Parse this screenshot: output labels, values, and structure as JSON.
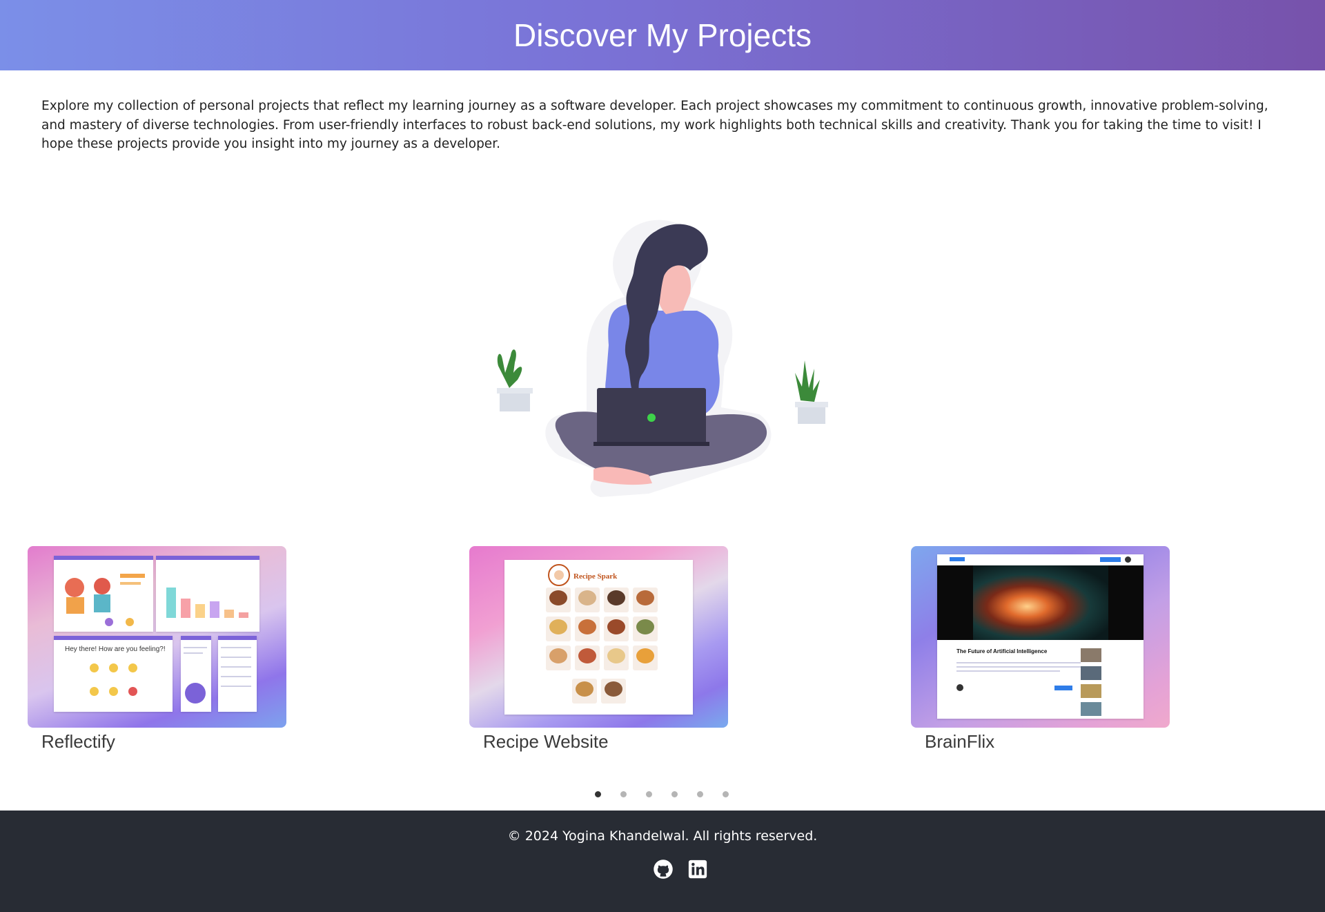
{
  "header": {
    "title": "Discover My Projects"
  },
  "intro": "Explore my collection of personal projects that reflect my learning journey as a software developer. Each project showcases my commitment to continuous growth, innovative problem-solving, and mastery of diverse technologies. From user-friendly interfaces to robust back-end solutions, my work highlights both technical skills and creativity. Thank you for taking the time to visit! I hope these projects provide you insight into my journey as a developer.",
  "projects": [
    {
      "title": "Reflectify",
      "screenshot_text": "Hey there! How are you feeling?!"
    },
    {
      "title": "Recipe Website",
      "screenshot_text": "Recipe Spark"
    },
    {
      "title": "BrainFlix",
      "screenshot_text": "The Future of Artificial Intelligence"
    }
  ],
  "carousel": {
    "total_slides": 6,
    "active_slide": 1
  },
  "footer": {
    "copyright": "© 2024 Yogina Khandelwal. All rights reserved.",
    "icons": [
      "github-icon",
      "linkedin-icon"
    ]
  },
  "colors": {
    "header_gradient_start": "#7b8fe8",
    "header_gradient_end": "#7752ab",
    "footer_bg": "#282c34",
    "accent": "#7986e8"
  }
}
